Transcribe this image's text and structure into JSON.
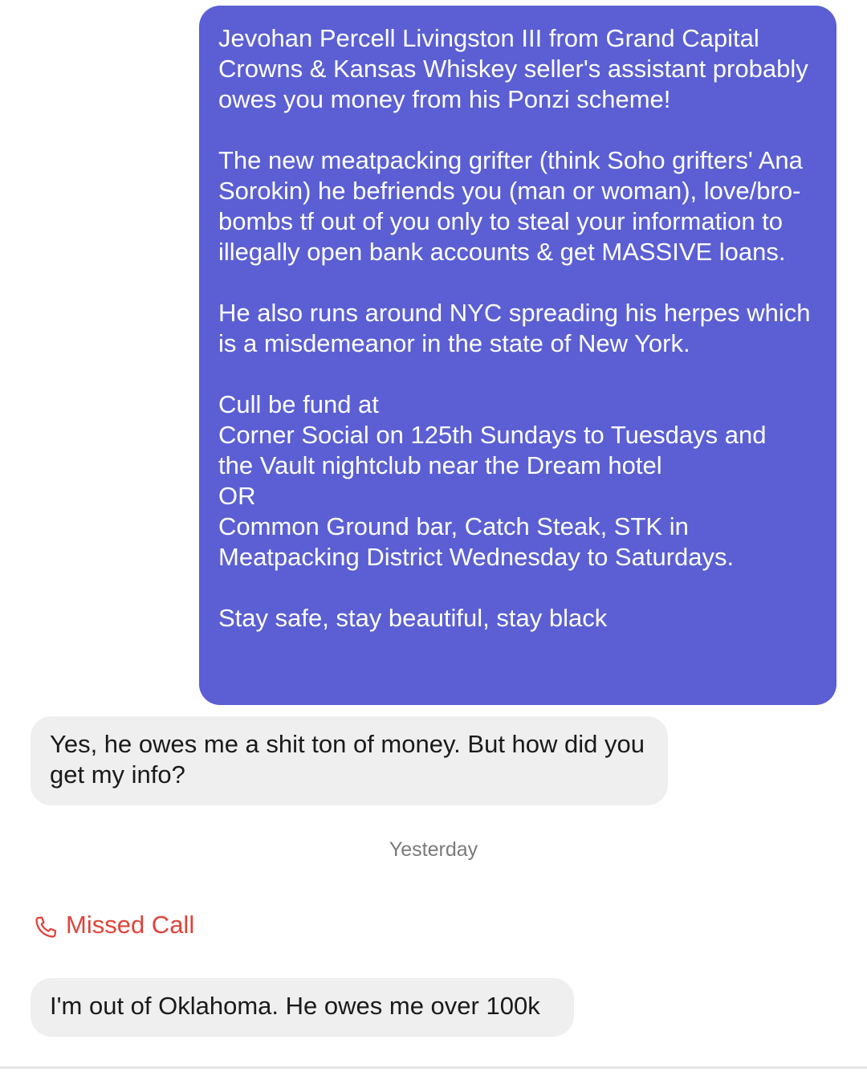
{
  "messages": {
    "outgoing_1": "Jevohan Percell Livingston III from Grand Capital Crowns & Kansas Whiskey seller's assistant probably owes you money from his Ponzi scheme!\n\nThe new meatpacking grifter (think Soho grifters' Ana Sorokin) he befriends you (man or woman), love/bro-bombs tf out of you only to steal your information to illegally open bank accounts & get MASSIVE loans.\n\nHe also runs around NYC spreading his herpes which is a misdemeanor in the state of New York.\n\nCull be fund at\nCorner Social on 125th Sundays to Tuesdays and\nthe Vault nightclub near the Dream hotel\nOR\nCommon Ground bar, Catch Steak, STK in Meatpacking District Wednesday to Saturdays.\n\nStay safe, stay beautiful, stay black",
    "incoming_1": "Yes, he owes me a shit ton of money. But how did you get my info?",
    "incoming_2": "I'm out of Oklahoma. He owes me over 100k"
  },
  "timestamp": "Yesterday",
  "missed_call": {
    "label": "Missed Call",
    "icon": "phone-icon",
    "color": "#e0433a"
  },
  "colors": {
    "outgoing_bubble": "#5b5fd3",
    "incoming_bubble": "#efefef"
  }
}
